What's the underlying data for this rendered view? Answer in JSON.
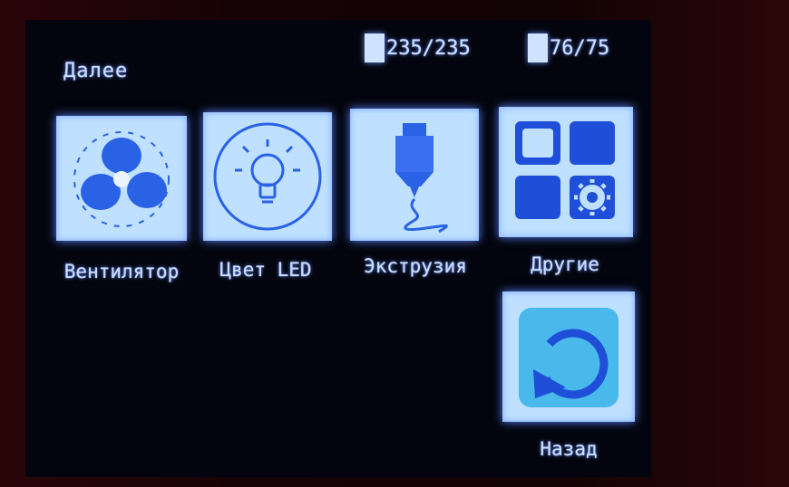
{
  "header": {
    "title": "Далее",
    "status": [
      {
        "icon": "nozzle-temp-icon",
        "text": "235/235"
      },
      {
        "icon": "bed-temp-icon",
        "text": "76/75"
      }
    ]
  },
  "menu": {
    "fan": {
      "icon": "fan-icon",
      "label": "Вентилятор"
    },
    "led": {
      "icon": "lightbulb-icon",
      "label": "Цвет LED"
    },
    "extrusion": {
      "icon": "extruder-icon",
      "label": "Экструзия"
    },
    "other": {
      "icon": "grid-gear-icon",
      "label": "Другие"
    },
    "back": {
      "icon": "back-arrow-icon",
      "label": "Назад"
    }
  },
  "colors": {
    "screen_bg": "#03040d",
    "tile_bg": "#bfe0ff",
    "icon_blue": "#1f58e8",
    "text_glow": "#5d86ff"
  }
}
